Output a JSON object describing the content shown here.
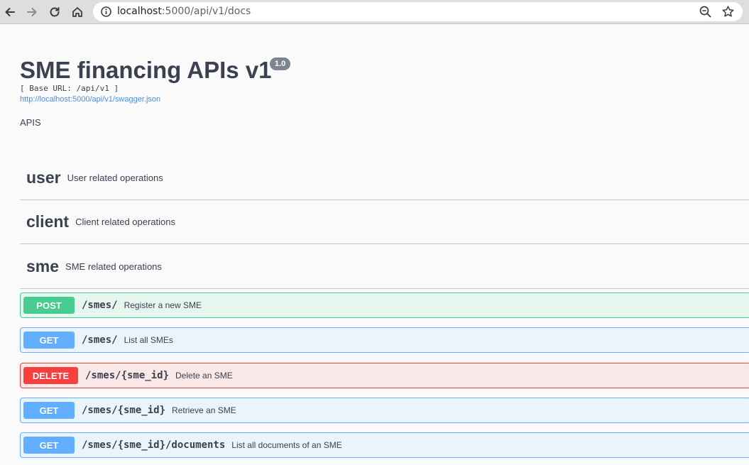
{
  "browser": {
    "url_host": "localhost",
    "url_rest": ":5000/api/v1/docs",
    "icons": [
      "back-arrow-icon",
      "forward-arrow-icon",
      "reload-icon",
      "home-icon",
      "info-icon",
      "zoom-out-icon",
      "bookmark-star-icon"
    ]
  },
  "info": {
    "title": "SME financing APIs v1",
    "version": "1.0",
    "base_url": "[ Base URL: /api/v1 ]",
    "spec_link": "http://localhost:5000/api/v1/swagger.json",
    "description": "APIS"
  },
  "tags": [
    {
      "name": "user",
      "description": "User related operations"
    },
    {
      "name": "client",
      "description": "Client related operations"
    },
    {
      "name": "sme",
      "description": "SME related operations"
    }
  ],
  "operations": [
    {
      "method": "POST",
      "path": "/smes/",
      "summary": "Register a new SME"
    },
    {
      "method": "GET",
      "path": "/smes/",
      "summary": "List all SMEs"
    },
    {
      "method": "DELETE",
      "path": "/smes/{sme_id}",
      "summary": "Delete an SME"
    },
    {
      "method": "GET",
      "path": "/smes/{sme_id}",
      "summary": "Retrieve an SME"
    },
    {
      "method": "GET",
      "path": "/smes/{sme_id}/documents",
      "summary": "List all documents of an SME"
    }
  ],
  "colors": {
    "post": "#49cc90",
    "get": "#61affe",
    "delete": "#f93e3e",
    "text": "#3b4151",
    "link": "#4990e2"
  }
}
